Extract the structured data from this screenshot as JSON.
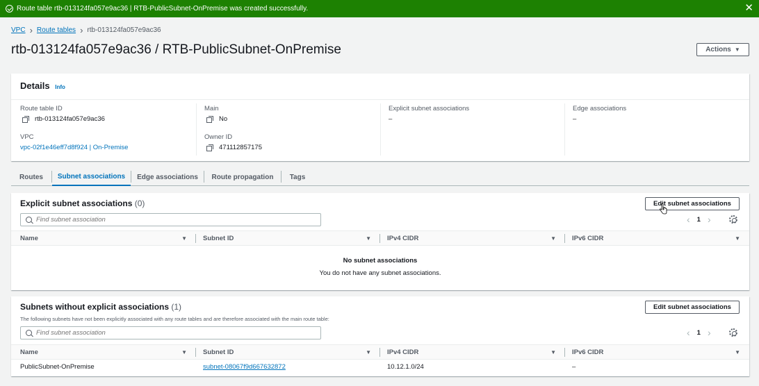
{
  "flash": {
    "message": "Route table rtb-013124fa057e9ac36 | RTB-PublicSubnet-OnPremise was created successfully.",
    "close": "✕",
    "color": "#1d8102"
  },
  "breadcrumbs": [
    "VPC",
    "Route tables",
    "rtb-013124fa057e9ac36"
  ],
  "page_title": "rtb-013124fa057e9ac36 / RTB-PublicSubnet-OnPremise",
  "actions_label": "Actions",
  "details": {
    "title": "Details",
    "info": "Info",
    "route_table_id_label": "Route table ID",
    "route_table_id": "rtb-013124fa057e9ac36",
    "vpc_label": "VPC",
    "vpc_value": "vpc-02f1e46eff7d8f924 | On-Premise",
    "main_label": "Main",
    "main_value": "No",
    "owner_label": "Owner ID",
    "owner_value": "471112857175",
    "explicit_label": "Explicit subnet associations",
    "explicit_value": "–",
    "edge_label": "Edge associations",
    "edge_value": "–"
  },
  "tabs": [
    {
      "label": "Routes",
      "active": false
    },
    {
      "label": "Subnet associations",
      "active": true
    },
    {
      "label": "Edge associations",
      "active": false
    },
    {
      "label": "Route propagation",
      "active": false
    },
    {
      "label": "Tags",
      "active": false
    }
  ],
  "explicit_section": {
    "title": "Explicit subnet associations",
    "count": "(0)",
    "edit_button": "Edit subnet associations",
    "search_placeholder": "Find subnet association",
    "page": "1",
    "columns": [
      "Name",
      "Subnet ID",
      "IPv4 CIDR",
      "IPv6 CIDR"
    ],
    "empty_title": "No subnet associations",
    "empty_text": "You do not have any subnet associations."
  },
  "without_section": {
    "title": "Subnets without explicit associations",
    "count": "(1)",
    "description": "The following subnets have not been explicitly associated with any route tables and are therefore associated with the main route table:",
    "edit_button": "Edit subnet associations",
    "search_placeholder": "Find subnet association",
    "page": "1",
    "columns": [
      "Name",
      "Subnet ID",
      "IPv4 CIDR",
      "IPv6 CIDR"
    ],
    "rows": [
      {
        "name": "PublicSubnet-OnPremise",
        "subnet_id": "subnet-08067f9d667632872",
        "ipv4": "10.12.1.0/24",
        "ipv6": "–"
      }
    ]
  },
  "icons": {
    "prev": "‹",
    "next": "›",
    "sort": "▼",
    "breadcrumb_sep": "›",
    "caret": "▼"
  }
}
